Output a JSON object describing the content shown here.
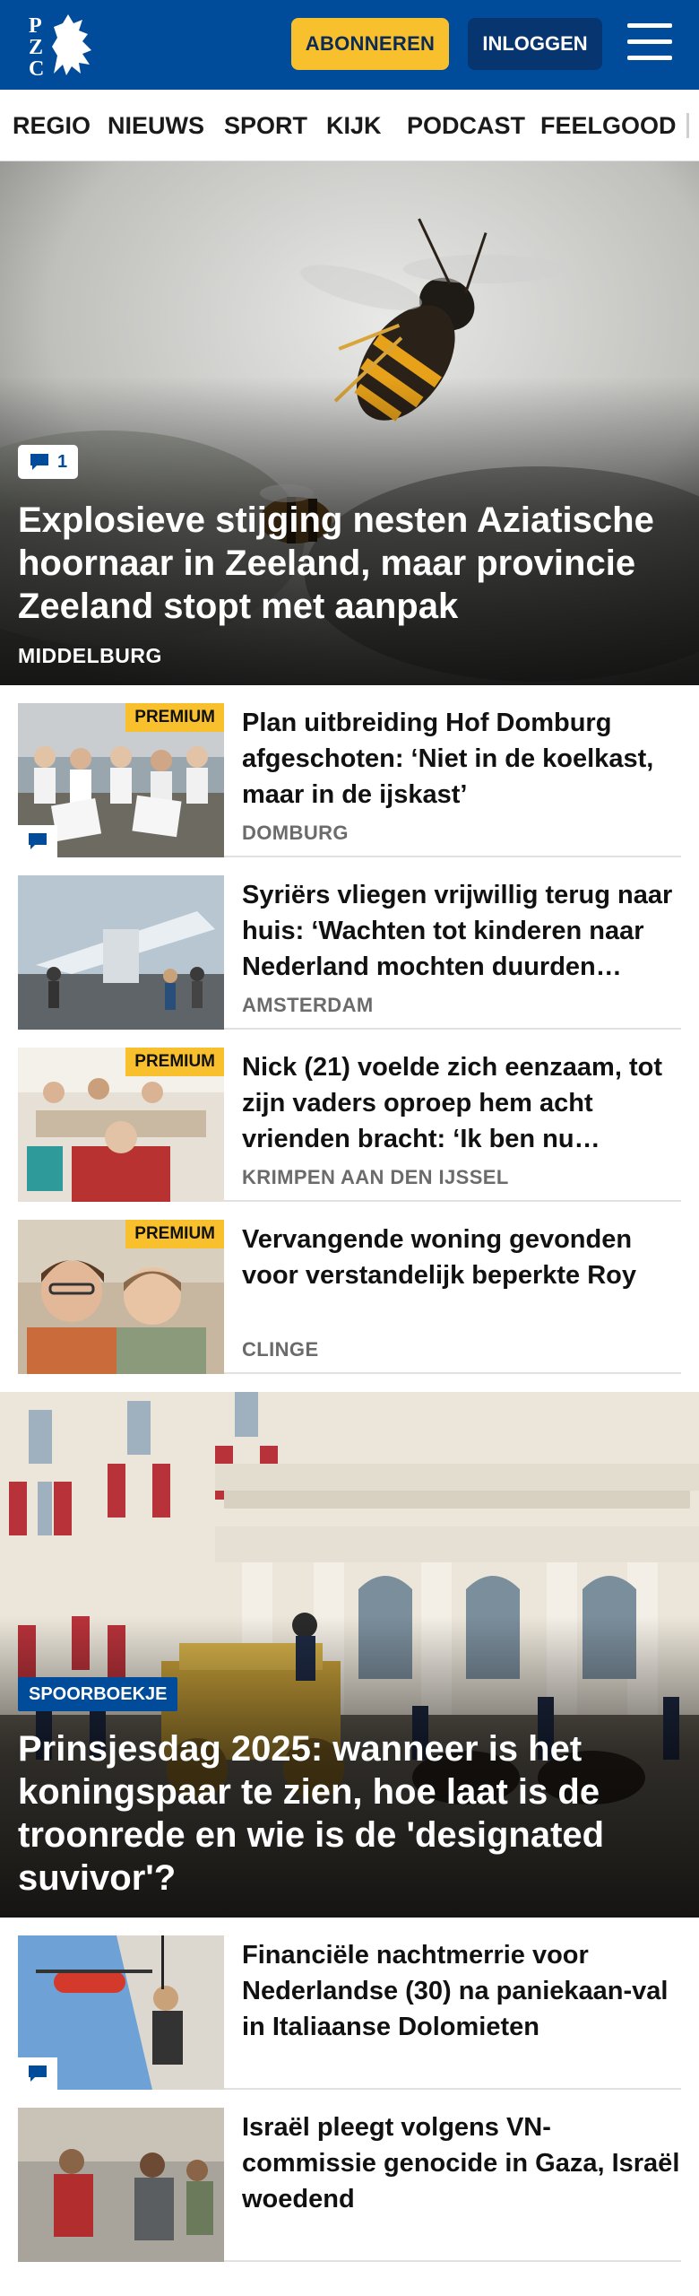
{
  "header": {
    "logo_text": "PZC",
    "subscribe_label": "ABONNEREN",
    "login_label": "INLOGGEN",
    "menu_icon": "hamburger-icon",
    "colors": {
      "brand": "#004b9a",
      "accent": "#f8c02c",
      "login_bg": "#06356f"
    }
  },
  "nav": {
    "items": [
      "REGIO",
      "NIEUWS",
      "SPORT",
      "KIJK",
      "PODCAST",
      "FEELGOOD"
    ]
  },
  "hero1": {
    "comment_count": "1",
    "title": "Explosieve stijging nesten Aziatische hoornaar in Zeeland, maar provincie Zeeland stopt met aanpak",
    "location": "MIDDELBURG"
  },
  "articles": [
    {
      "title": "Plan uitbreiding Hof Domburg afgeschoten: ‘Niet in de koelkast, maar in de ijskast’",
      "location": "DOMBURG",
      "badge": "PREMIUM"
    },
    {
      "title": "Syriërs vliegen vrijwillig terug naar huis: ‘Wachten tot kinderen naar Nederland mochten duurden…",
      "location": "AMSTERDAM"
    },
    {
      "title": "Nick (21) voelde zich eenzaam, tot zijn vaders oproep hem acht vrienden bracht: ‘Ik ben nu…",
      "location": "KRIMPEN AAN DEN IJSSEL",
      "badge": "PREMIUM"
    },
    {
      "title": "Vervangende woning gevonden voor verstandelijk beperkte Roy",
      "location": "CLINGE",
      "badge": "PREMIUM"
    }
  ],
  "hero2": {
    "tag": "SPOORBOEKJE",
    "title": "Prinsjesdag 2025: wanneer is het koningspaar te zien, hoe laat is de troonrede en wie is de 'designated suvivor'?"
  },
  "articles2": [
    {
      "title": "Financiële nachtmerrie voor Nederlandse (30) na paniekaan-val in Italiaanse Dolomieten"
    },
    {
      "title": "Israël pleegt volgens VN-commissie genocide in Gaza, Israël woedend"
    }
  ]
}
